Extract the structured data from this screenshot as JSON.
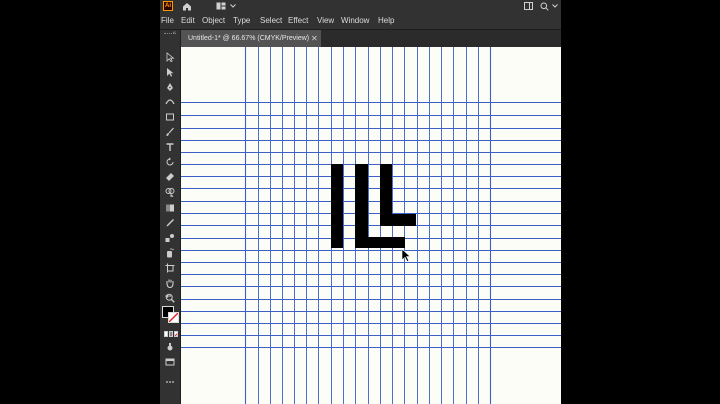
{
  "app": {
    "logo_text": "Ai"
  },
  "titlebar": {
    "icons": [
      "home-icon",
      "workspace-icon",
      "chevron-down-icon",
      "panel-icon",
      "search-icon"
    ]
  },
  "menu": [
    "File",
    "Edit",
    "Object",
    "Type",
    "Select",
    "Effect",
    "View",
    "Window",
    "Help"
  ],
  "document": {
    "tab_title": "Untitled-1* @ 66.67% (CMYK/Preview)",
    "close_glyph": "✕"
  },
  "tools": [
    "selection-tool-icon",
    "direct-selection-tool-icon",
    "pen-tool-icon",
    "curvature-tool-icon",
    "rectangle-tool-icon",
    "paintbrush-tool-icon",
    "type-tool-icon",
    "rotate-tool-icon",
    "eraser-tool-icon",
    "shape-builder-tool-icon",
    "gradient-tool-icon",
    "eyedropper-tool-icon",
    "blend-tool-icon",
    "symbol-sprayer-tool-icon",
    "artboard-tool-icon",
    "hand-tool-icon",
    "zoom-tool-icon",
    "fill-stroke-swatches",
    "drawing-mode-icon",
    "screen-mode-icon",
    "more-tools-icon"
  ],
  "colors": {
    "guide": "#3b5fc6",
    "artwork": "#000000",
    "canvas": "#fdfdf7",
    "ui_dark": "#323232",
    "accent": "#ff9a00"
  }
}
